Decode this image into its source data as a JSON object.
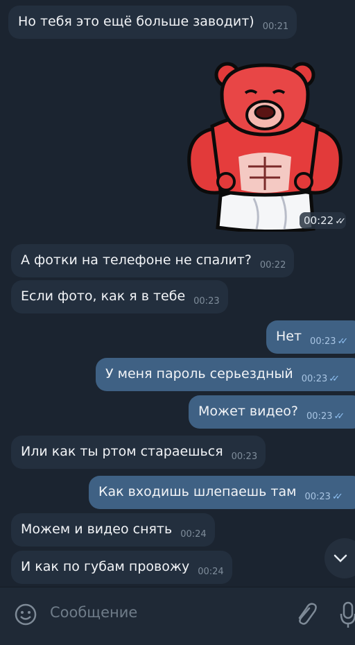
{
  "messages": [
    {
      "text": "Но тебя это ещё больше заводит)",
      "time": "00:21",
      "side": "in"
    },
    {
      "text": "",
      "time": "00:22",
      "side": "out",
      "type": "sticker"
    },
    {
      "text": "А фотки на телефоне не спалит?",
      "time": "00:22",
      "side": "in"
    },
    {
      "text": "Если фото, как я в тебе",
      "time": "00:23",
      "side": "in"
    },
    {
      "text": "Нет",
      "time": "00:23",
      "side": "out"
    },
    {
      "text": "У меня пароль серьездный",
      "time": "00:23",
      "side": "out"
    },
    {
      "text": "Может видео?",
      "time": "00:23",
      "side": "out"
    },
    {
      "text": "Или как ты ртом стараешься",
      "time": "00:23",
      "side": "in"
    },
    {
      "text": "Как входишь шлепаешь там",
      "time": "00:23",
      "side": "out"
    },
    {
      "text": "Можем и видео снять",
      "time": "00:24",
      "side": "in"
    },
    {
      "text": "И как по губам провожу",
      "time": "00:24",
      "side": "in"
    }
  ],
  "composer": {
    "placeholder": "Сообщение"
  },
  "icons": [
    "emoji-icon",
    "attach-icon",
    "mic-icon",
    "chevron-down-icon",
    "double-check-icon"
  ],
  "colors": {
    "background": "#1b2430",
    "incoming": "#232f3e",
    "outgoing": "#3f6184",
    "read_ticks": "#8fc0f2"
  }
}
